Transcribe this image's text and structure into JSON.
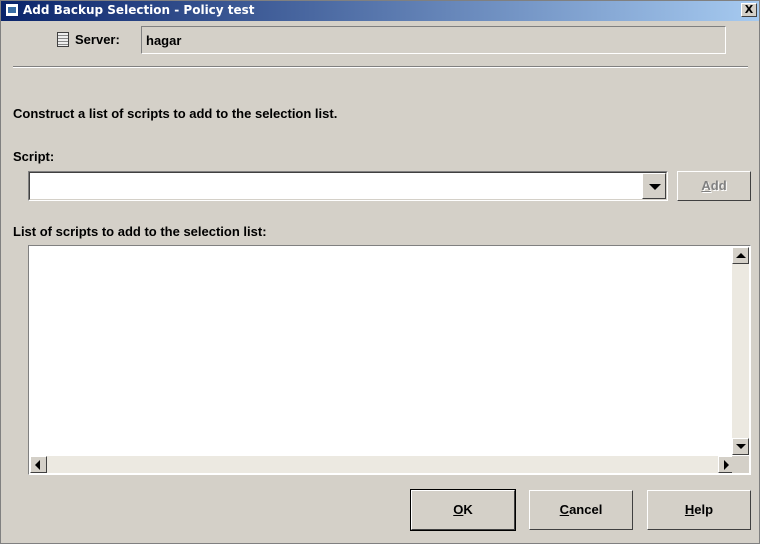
{
  "window": {
    "title": "Add Backup Selection - Policy test",
    "close_label": "X"
  },
  "server": {
    "label": "Server:",
    "value": "hagar"
  },
  "instructions": "Construct a list of scripts to add to the selection list.",
  "script": {
    "label": "Script:",
    "value": ""
  },
  "add_button": {
    "mnemonic": "A",
    "rest": "dd"
  },
  "list": {
    "label": "List of scripts to add to the selection list:",
    "items": []
  },
  "buttons": {
    "ok": {
      "mnemonic": "O",
      "rest": "K"
    },
    "cancel": {
      "mnemonic": "C",
      "rest": "ancel"
    },
    "help": {
      "mnemonic": "H",
      "rest": "elp"
    }
  },
  "colors": {
    "titlebar_start": "#0a246a",
    "titlebar_end": "#a6caf0",
    "dialog_bg": "#d4d0c8"
  }
}
